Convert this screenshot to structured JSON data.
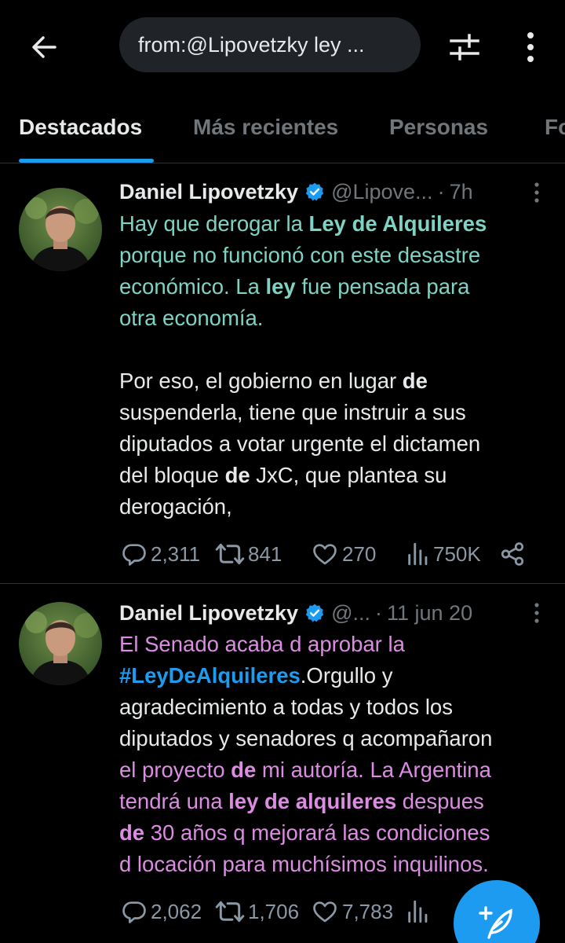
{
  "search": {
    "query": "from:@Lipovetzky ley ..."
  },
  "tabs": [
    {
      "label": "Destacados"
    },
    {
      "label": "Más recientes"
    },
    {
      "label": "Personas"
    },
    {
      "label": "Fo"
    }
  ],
  "tweets": [
    {
      "name": "Daniel Lipovetzky",
      "handle": "@Lipove...",
      "time": "7h",
      "lines": [
        [
          {
            "t": "Hay que derogar la ",
            "c": "teal"
          },
          {
            "t": "Ley de Alquileres",
            "c": "teal b"
          }
        ],
        [
          {
            "t": "porque no funcionó con este desastre",
            "c": "teal"
          }
        ],
        [
          {
            "t": "económico. La ",
            "c": "teal"
          },
          {
            "t": "ley",
            "c": "teal b"
          },
          {
            "t": " fue pensada para",
            "c": "teal"
          }
        ],
        [
          {
            "t": "otra economía.",
            "c": "teal"
          }
        ],
        [
          {
            "t": "",
            "c": "white"
          }
        ],
        [
          {
            "t": "Por eso, el gobierno en lugar ",
            "c": "white"
          },
          {
            "t": "de",
            "c": "white b"
          }
        ],
        [
          {
            "t": "suspenderla, tiene que instruir a sus",
            "c": "white"
          }
        ],
        [
          {
            "t": "diputados a votar urgente el dictamen",
            "c": "white"
          }
        ],
        [
          {
            "t": "del bloque ",
            "c": "white"
          },
          {
            "t": "de",
            "c": "white b"
          },
          {
            "t": " JxC, que plantea su",
            "c": "white"
          }
        ],
        [
          {
            "t": "derogación,",
            "c": "white"
          }
        ]
      ],
      "replies": "2,311",
      "retweets": "841",
      "likes": "270",
      "views": "750K"
    },
    {
      "name": "Daniel Lipovetzky",
      "handle": "@...",
      "time": "11 jun 20",
      "lines": [
        [
          {
            "t": "El Senado acaba d aprobar la",
            "c": "pink"
          }
        ],
        [
          {
            "t": "#LeyDeAlquileres",
            "c": "blue"
          },
          {
            "t": ".Orgullo y",
            "c": "white"
          }
        ],
        [
          {
            "t": "agradecimiento a todas y todos los",
            "c": "white"
          }
        ],
        [
          {
            "t": "diputados y senadores q acompañaron",
            "c": "white"
          }
        ],
        [
          {
            "t": "el proyecto ",
            "c": "pink"
          },
          {
            "t": "de",
            "c": "pink b"
          },
          {
            "t": " mi autoría. La Argentina",
            "c": "pink"
          }
        ],
        [
          {
            "t": "tendrá una ",
            "c": "pink"
          },
          {
            "t": "ley de alquileres",
            "c": "pink b"
          },
          {
            "t": " despues",
            "c": "pink"
          }
        ],
        [
          {
            "t": "de",
            "c": "pink b"
          },
          {
            "t": " 30 años q mejorará las condiciones",
            "c": "pink"
          }
        ],
        [
          {
            "t": "d locación para muchísimos inquilinos.",
            "c": "pink"
          }
        ]
      ],
      "replies": "2,062",
      "retweets": "1,706",
      "likes": "7,783",
      "views": ""
    }
  ],
  "colors": {
    "accent": "#1d9bf0",
    "highlight_teal": "#7fd3c4",
    "highlight_pink": "#dc8ce2",
    "muted": "#71767b",
    "background": "#000000"
  },
  "icons": [
    "back-arrow-icon",
    "filter-sliders-icon",
    "more-vertical-icon",
    "verified-badge-icon",
    "reply-icon",
    "retweet-icon",
    "like-icon",
    "views-icon",
    "share-icon",
    "compose-icon"
  ]
}
